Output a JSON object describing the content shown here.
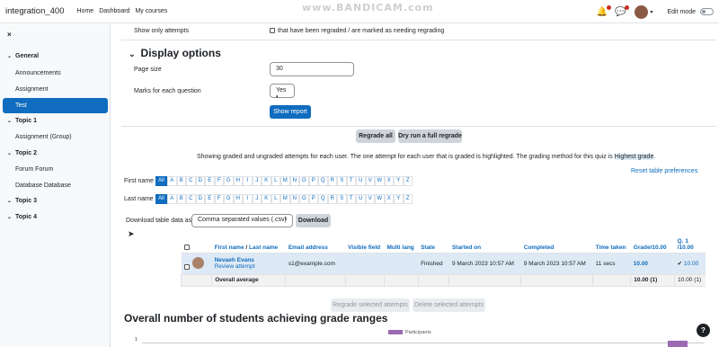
{
  "topbar": {
    "site_name": "integration_400",
    "nav": [
      "Home",
      "Dashboard",
      "My courses"
    ],
    "watermark": "www.BANDICAM.com",
    "edit_mode": "Edit mode"
  },
  "drawer": {
    "close": "×",
    "sections": [
      {
        "label": "General",
        "items": [
          "Announcements",
          "Assignment",
          "Test"
        ]
      },
      {
        "label": "Topic 1",
        "items": [
          "Assignment (Group)"
        ]
      },
      {
        "label": "Topic 2",
        "items": [
          "Forum Forum",
          "Database Database"
        ]
      },
      {
        "label": "Topic 3",
        "items": []
      },
      {
        "label": "Topic 4",
        "items": []
      }
    ],
    "active": "Test"
  },
  "options": {
    "show_only_attempts": "Show only attempts",
    "regraded_label": "that have been regraded / are marked as needing regrading",
    "display_options": "Display options",
    "page_size_label": "Page size",
    "page_size_value": "30",
    "marks_label": "Marks for each question",
    "marks_value": "Yes",
    "show_report": "Show report"
  },
  "regrade": {
    "regrade_all": "Regrade all",
    "dry_run": "Dry run a full regrade"
  },
  "info": {
    "text": "Showing graded and ungraded attempts for each user. The one attempt for each user that is graded is highlighted. The grading method for this quiz is ",
    "method": "Highest grade",
    "end": ".",
    "reset": "Reset table preferences"
  },
  "filters": {
    "first_name": "First name",
    "last_name": "Last name",
    "all": "All",
    "letters": [
      "A",
      "B",
      "C",
      "D",
      "E",
      "F",
      "G",
      "H",
      "I",
      "J",
      "K",
      "L",
      "M",
      "N",
      "O",
      "P",
      "Q",
      "R",
      "S",
      "T",
      "U",
      "V",
      "W",
      "X",
      "Y",
      "Z"
    ]
  },
  "download": {
    "label": "Download table data as",
    "format": "Comma separated values (.csv)",
    "button": "Download"
  },
  "table": {
    "headers": {
      "first": "First name",
      "sep": " / ",
      "last": "Last name",
      "email": "Email address",
      "visible": "Visible field",
      "multi": "Multi lang",
      "state": "State",
      "started": "Started on",
      "completed": "Completed",
      "time": "Time taken",
      "grade": "Grade/10.00",
      "q1": "Q. 1 /10.00"
    },
    "row": {
      "name": "Nevaeh Evans",
      "review": "Review attempt",
      "email": "s1@example.com",
      "state": "Finished",
      "started": "9 March 2023 10:57 AM",
      "completed": "9 March 2023 10:57 AM",
      "time": "11 secs",
      "grade": "10.00",
      "q1_mark": "✔",
      "q1": "10.00"
    },
    "avg": {
      "label": "Overall average",
      "grade": "10.00 (1)",
      "q1": "10.00 (1)"
    }
  },
  "actions": {
    "regrade_selected": "Regrade selected attempts",
    "delete_selected": "Delete selected attempts"
  },
  "chart": {
    "heading": "Overall number of students achieving grade ranges",
    "legend": "Participants",
    "y_tick": "1",
    "color": "#9b6ab3"
  }
}
